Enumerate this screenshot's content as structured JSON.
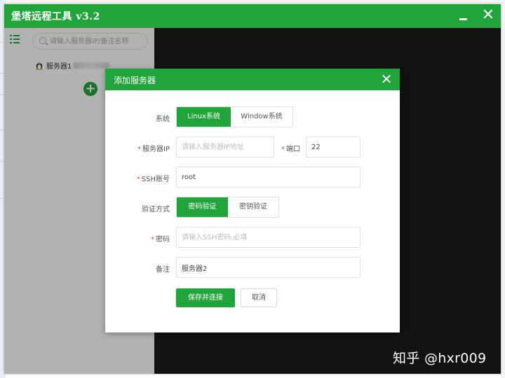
{
  "window": {
    "title": "堡塔远程工具 v3.2",
    "close_glyph": "✕"
  },
  "sidebar": {
    "search_placeholder": "请输入服务器IP/备注名称",
    "servers": [
      {
        "name": "服务器1",
        "icon": "linux-penguin-icon"
      }
    ],
    "add_glyph": "+"
  },
  "dialog": {
    "title": "添加服务器",
    "close_glyph": "✕",
    "system": {
      "label": "系统",
      "options": [
        "Linux系统",
        "Window系统"
      ],
      "selected": "Linux系统"
    },
    "server_ip": {
      "label": "服务器IP",
      "placeholder": "请输入服务器IP地址",
      "value": ""
    },
    "port": {
      "label": "端口",
      "value": "22"
    },
    "ssh_account": {
      "label": "SSH账号",
      "value": "root"
    },
    "auth": {
      "label": "验证方式",
      "options": [
        "密码验证",
        "密钥验证"
      ],
      "selected": "密码验证"
    },
    "password": {
      "label": "密码",
      "placeholder": "请输入SSH密码,必填",
      "value": ""
    },
    "note": {
      "label": "备注",
      "value": "服务器2"
    },
    "save_label": "保存并连接",
    "cancel_label": "取消",
    "required_mark": "*"
  },
  "watermark": "知乎 @hxr009",
  "colors": {
    "accent": "#20a53a",
    "required": "#e74c3c",
    "terminal_bg": "#1b1b1b"
  }
}
